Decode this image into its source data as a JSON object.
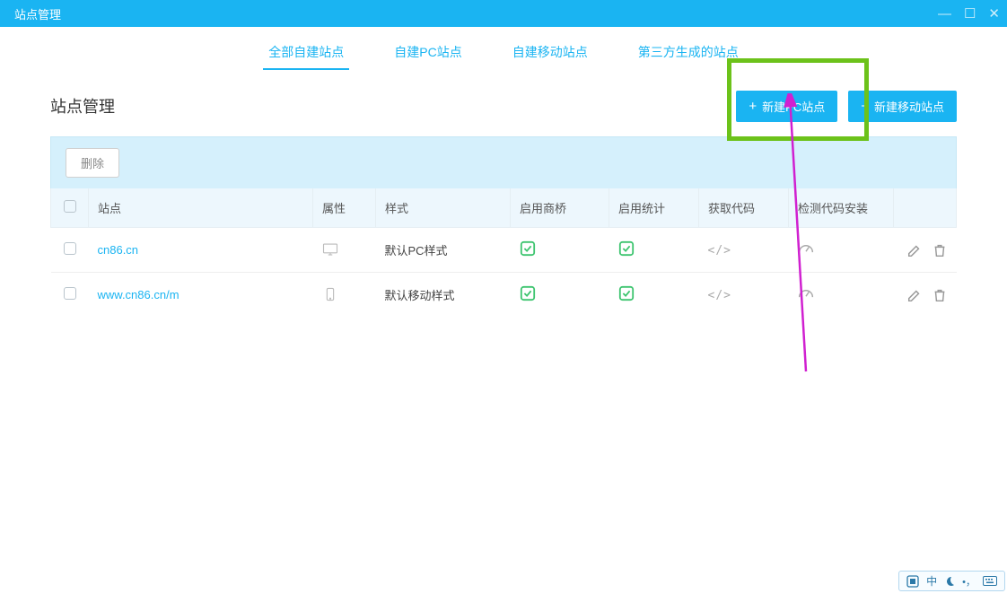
{
  "window": {
    "title": "站点管理"
  },
  "tabs": {
    "all": "全部自建站点",
    "pc": "自建PC站点",
    "mobile": "自建移动站点",
    "third": "第三方生成的站点"
  },
  "page": {
    "title": "站点管理"
  },
  "buttons": {
    "new_pc": "新建PC站点",
    "new_mobile": "新建移动站点",
    "delete": "删除"
  },
  "headers": {
    "site": "站点",
    "attr": "属性",
    "style": "样式",
    "enable_bridge": "启用商桥",
    "enable_stats": "启用统计",
    "get_code": "获取代码",
    "check_code": "检测代码安装"
  },
  "rows": [
    {
      "site": "cn86.cn",
      "style": "默认PC样式",
      "device": "desktop"
    },
    {
      "site": "www.cn86.cn/m",
      "style": "默认移动样式",
      "device": "mobile"
    }
  ],
  "ime": {
    "zhong": "中"
  }
}
